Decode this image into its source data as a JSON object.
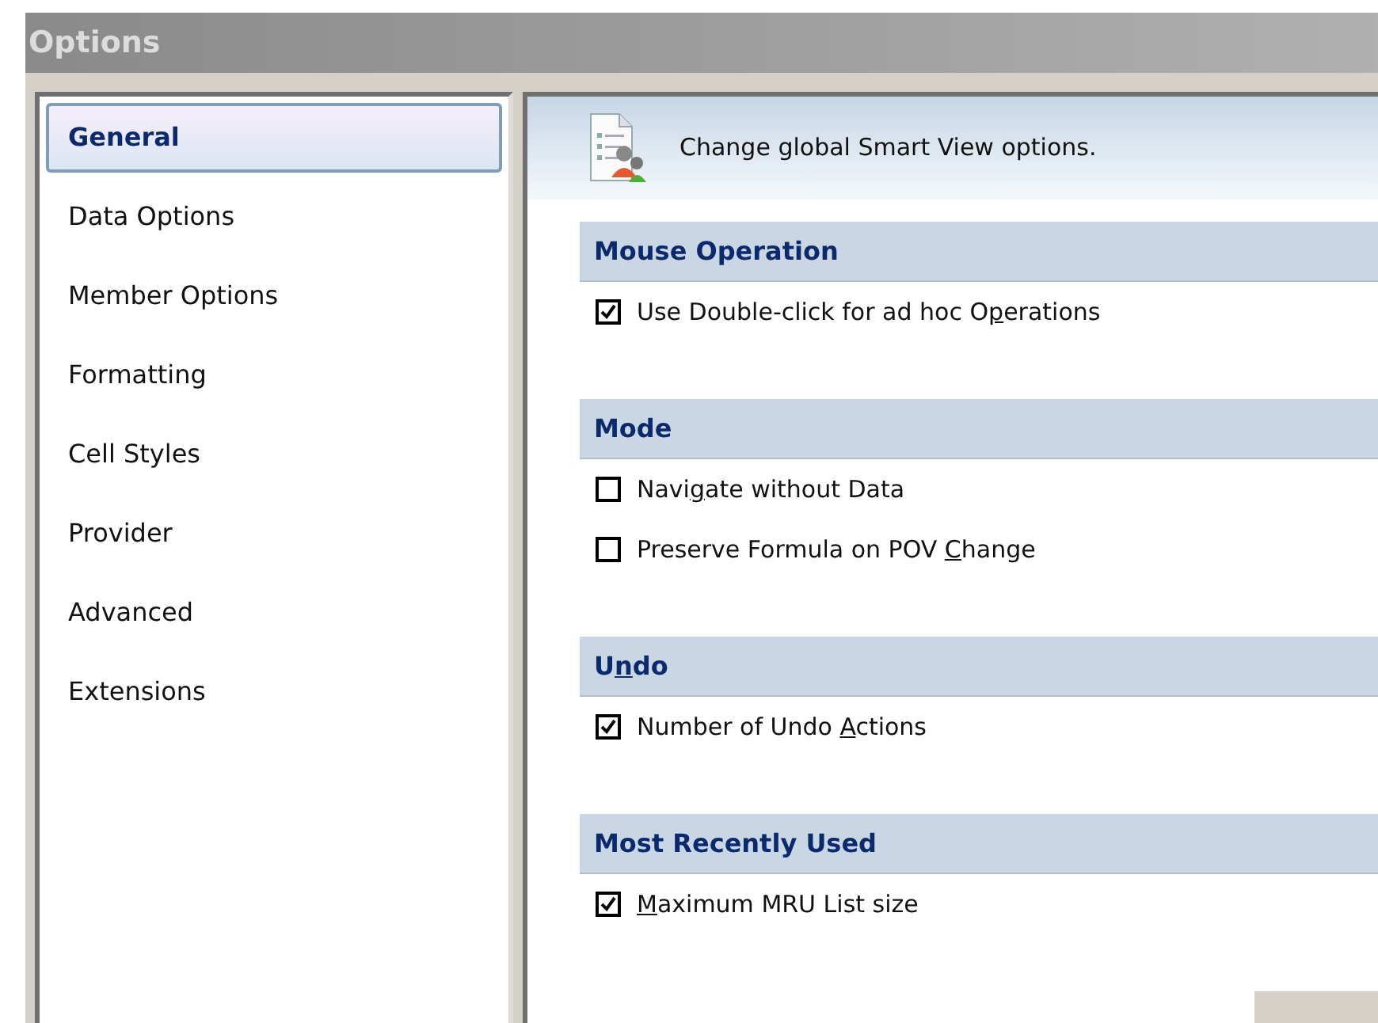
{
  "window": {
    "title": "Options"
  },
  "sidebar": {
    "items": [
      {
        "label": "General",
        "selected": true
      },
      {
        "label": "Data Options",
        "selected": false
      },
      {
        "label": "Member Options",
        "selected": false
      },
      {
        "label": "Formatting",
        "selected": false
      },
      {
        "label": "Cell Styles",
        "selected": false
      },
      {
        "label": "Provider",
        "selected": false
      },
      {
        "label": "Advanced",
        "selected": false
      },
      {
        "label": "Extensions",
        "selected": false
      }
    ]
  },
  "header": {
    "text": "Change global Smart View options."
  },
  "sections": [
    {
      "title": [
        {
          "text": "Mouse Operation",
          "underlined": false
        }
      ],
      "options": [
        {
          "label": [
            {
              "text": "Use Double-click for ad hoc O",
              "underlined": false
            },
            {
              "text": "p",
              "underlined": true
            },
            {
              "text": "erations",
              "underlined": false
            }
          ],
          "checked": true
        }
      ]
    },
    {
      "title": [
        {
          "text": "Mode",
          "underlined": false
        }
      ],
      "options": [
        {
          "label": [
            {
              "text": "Navi",
              "underlined": false
            },
            {
              "text": "g",
              "underlined": true
            },
            {
              "text": "ate without Data",
              "underlined": false
            }
          ],
          "checked": false
        },
        {
          "label": [
            {
              "text": "Preserve Formula on POV ",
              "underlined": false
            },
            {
              "text": "C",
              "underlined": true
            },
            {
              "text": "hange",
              "underlined": false
            }
          ],
          "checked": false
        }
      ]
    },
    {
      "title": [
        {
          "text": "U",
          "underlined": false
        },
        {
          "text": "n",
          "underlined": true
        },
        {
          "text": "do",
          "underlined": false
        }
      ],
      "options": [
        {
          "label": [
            {
              "text": "Number of Undo ",
              "underlined": false
            },
            {
              "text": "A",
              "underlined": true
            },
            {
              "text": "ctions",
              "underlined": false
            }
          ],
          "checked": true
        }
      ]
    },
    {
      "title": [
        {
          "text": "Most Recently Used",
          "underlined": false
        }
      ],
      "options": [
        {
          "label": [
            {
              "text": "M",
              "underlined": true
            },
            {
              "text": "aximum MRU List size",
              "underlined": false
            }
          ],
          "checked": true
        }
      ]
    }
  ]
}
